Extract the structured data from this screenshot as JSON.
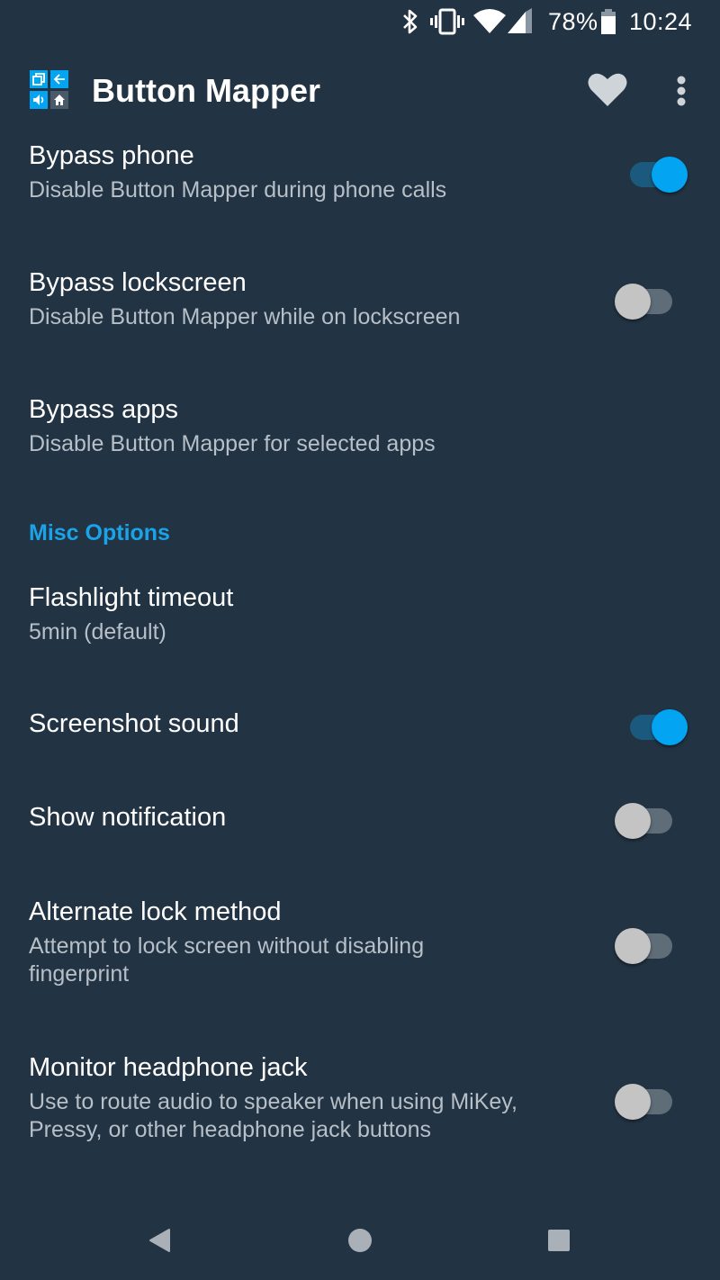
{
  "status_bar": {
    "battery_percent": "78%",
    "time": "10:24",
    "icons": [
      "bluetooth-icon",
      "vibrate-icon",
      "wifi-icon",
      "cell-signal-icon",
      "battery-icon"
    ]
  },
  "app_bar": {
    "title": "Button Mapper",
    "actions": [
      "heart-icon",
      "more-vert-icon"
    ]
  },
  "preferences": [
    {
      "id": "bypass-phone",
      "title": "Bypass phone",
      "summary": "Disable Button Mapper during phone calls",
      "toggle": true,
      "checked": true
    },
    {
      "id": "bypass-lockscreen",
      "title": "Bypass lockscreen",
      "summary": "Disable Button Mapper while on lockscreen",
      "toggle": true,
      "checked": false
    },
    {
      "id": "bypass-apps",
      "title": "Bypass apps",
      "summary": "Disable Button Mapper for selected apps",
      "toggle": false
    }
  ],
  "misc_section": {
    "header": "Misc Options",
    "items": [
      {
        "id": "flashlight-timeout",
        "title": "Flashlight timeout",
        "summary": "5min (default)",
        "toggle": false
      },
      {
        "id": "screenshot-sound",
        "title": "Screenshot sound",
        "toggle": true,
        "checked": true
      },
      {
        "id": "show-notification",
        "title": "Show notification",
        "toggle": true,
        "checked": false
      },
      {
        "id": "alternate-lock-method",
        "title": "Alternate lock method",
        "summary": "Attempt to lock screen without disabling fingerprint",
        "toggle": true,
        "checked": false
      },
      {
        "id": "monitor-headphone-jack",
        "title": "Monitor headphone jack",
        "summary": "Use to route audio to speaker when using MiKey, Pressy, or other headphone jack buttons",
        "toggle": true,
        "checked": false
      }
    ]
  },
  "colors": {
    "background": "#223343",
    "accent": "#03a5f2",
    "section_header": "#1aa3e8",
    "summary_text": "#b7bfc7"
  },
  "nav_bar": {
    "buttons": [
      "back-icon",
      "home-icon",
      "recents-icon"
    ]
  }
}
